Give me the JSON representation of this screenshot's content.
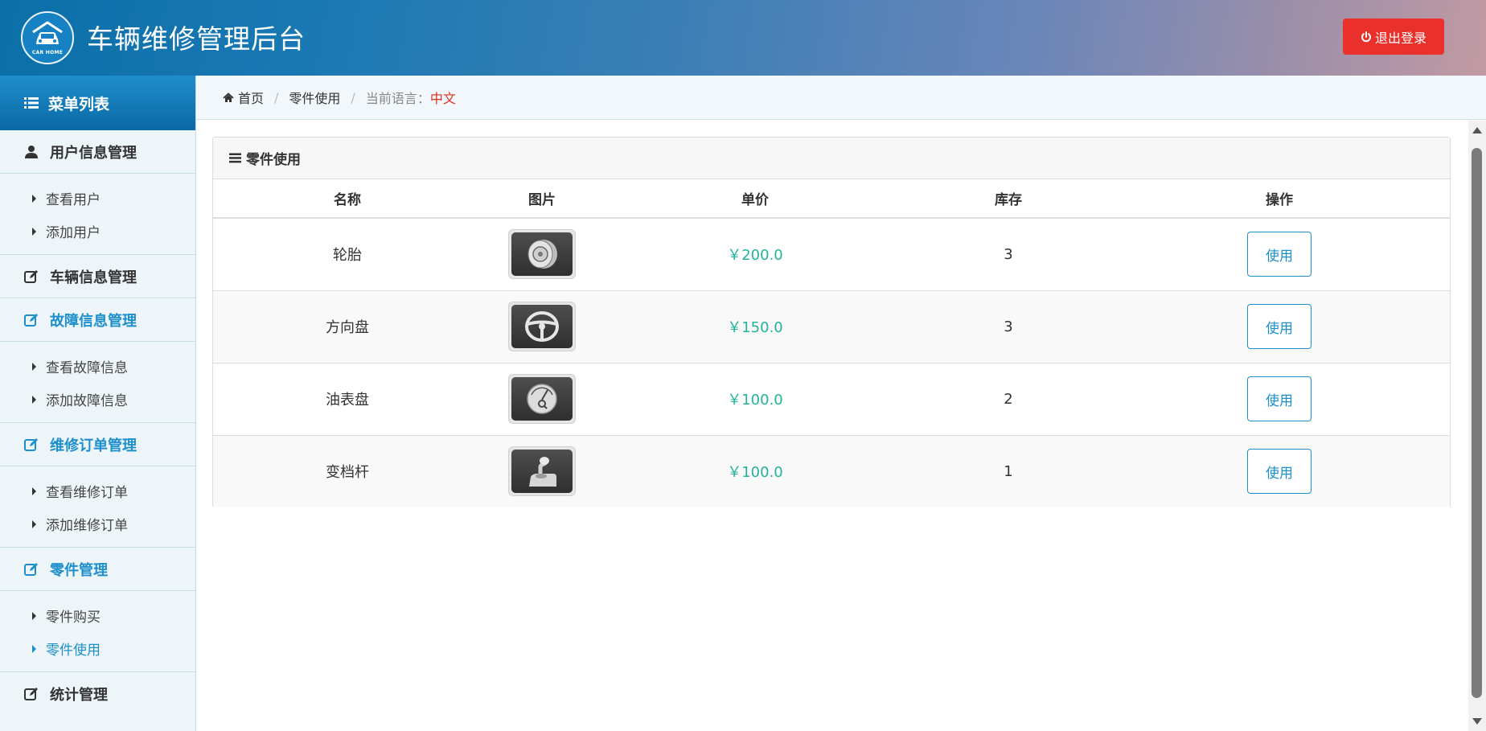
{
  "header": {
    "logo_text": "CAR HOME",
    "title": "车辆维修管理后台",
    "logout_label": "退出登录"
  },
  "sidebar": {
    "heading": "菜单列表",
    "groups": [
      {
        "label": "用户信息管理",
        "icon": "user-icon",
        "active": false,
        "items": [
          {
            "label": "查看用户"
          },
          {
            "label": "添加用户"
          }
        ]
      },
      {
        "label": "车辆信息管理",
        "icon": "edit-icon",
        "active": false,
        "items": []
      },
      {
        "label": "故障信息管理",
        "icon": "edit-icon",
        "active": true,
        "items": [
          {
            "label": "查看故障信息"
          },
          {
            "label": "添加故障信息"
          }
        ]
      },
      {
        "label": "维修订单管理",
        "icon": "edit-icon",
        "active": true,
        "items": [
          {
            "label": "查看维修订单"
          },
          {
            "label": "添加维修订单"
          }
        ]
      },
      {
        "label": "零件管理",
        "icon": "edit-icon",
        "active": true,
        "items": [
          {
            "label": "零件购买"
          },
          {
            "label": "零件使用",
            "active": true
          }
        ]
      },
      {
        "label": "统计管理",
        "icon": "edit-icon",
        "active": false,
        "items": []
      }
    ]
  },
  "breadcrumb": {
    "home": "首页",
    "current": "零件使用",
    "lang_label": "当前语言：",
    "lang_value": "中文"
  },
  "panel": {
    "title": "零件使用",
    "columns": [
      "名称",
      "图片",
      "单价",
      "库存",
      "操作"
    ],
    "rows": [
      {
        "name": "轮胎",
        "image": "tire-icon",
        "price": "￥200.0",
        "stock": "3",
        "action": "使用"
      },
      {
        "name": "方向盘",
        "image": "steering-wheel-icon",
        "price": "￥150.0",
        "stock": "3",
        "action": "使用"
      },
      {
        "name": "油表盘",
        "image": "fuel-gauge-icon",
        "price": "￥100.0",
        "stock": "2",
        "action": "使用"
      },
      {
        "name": "变档杆",
        "image": "gear-shift-icon",
        "price": "￥100.0",
        "stock": "1",
        "action": "使用"
      }
    ]
  },
  "colors": {
    "accent": "#1c8fcc",
    "logout": "#e9302b",
    "price": "#22b39a",
    "language": "#e0301e"
  }
}
